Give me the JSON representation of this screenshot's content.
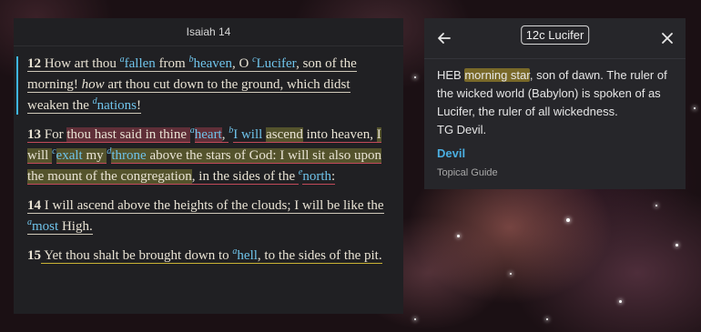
{
  "reader": {
    "chapter_title": "Isaiah 14",
    "verses": [
      {
        "num": "12",
        "t1": " How art thou ",
        "fn1": "a",
        "w1": "fallen",
        "t2": " from ",
        "fn2": "b",
        "w2": "heaven",
        "t3": ", O ",
        "fn3": "c",
        "w3": "Lucifer",
        "t4": ", son of the morning! ",
        "t5": "how",
        "t6": " art thou cut down to the ground, which didst weaken the ",
        "fn4": "d",
        "w4": "nations",
        "t7": "!"
      },
      {
        "num": "13",
        "t0": " For ",
        "h1": "thou hast said in thine ",
        "fn1": "a",
        "w1": "heart",
        "t1": ", ",
        "fn2": "b",
        "w2": "I will ",
        "w2b": "ascend",
        "t2": " into heaven, ",
        "h2": "I will ",
        "fn3": "c",
        "w3": "exalt",
        "t3": " my ",
        "fn4": "d",
        "w4": "throne",
        "t4": " above the stars of God: I will sit also upon ",
        "h3": "the mount of the congregation",
        "t5": ", ",
        "t6": "in the sides of the ",
        "fn5": "e",
        "w5": "north",
        "t7": ":"
      },
      {
        "num": "14",
        "t1": " I will ascend above the heights of the clouds; I will be like the ",
        "fn1": "a",
        "w1": "most",
        "t2": " High."
      },
      {
        "num": "15",
        "t1": " Yet thou shalt be brought down to ",
        "fn1": "a",
        "w1": "hell",
        "t2": ", to the sides of the pit."
      }
    ]
  },
  "popup": {
    "ref_label": "12c Lucifer",
    "text_before": "HEB ",
    "highlight": "morning star",
    "text_after": ", son of dawn. The ruler of the wicked world (Babylon) is spoken of as Lucifer, the ruler of all wickedness.",
    "tg_line": "TG Devil.",
    "topic": "Devil",
    "topic_source": "Topical Guide",
    "back_icon": "arrow-left-icon",
    "close_icon": "close-icon"
  },
  "colors": {
    "footnote_link": "#6fc3ea",
    "active_bar": "#3fb6e4",
    "topic_link": "#4aaee0",
    "highlight_yellow": "#bea028",
    "underline_red": "#c24a5a",
    "underline_yellow": "#c9b234"
  }
}
